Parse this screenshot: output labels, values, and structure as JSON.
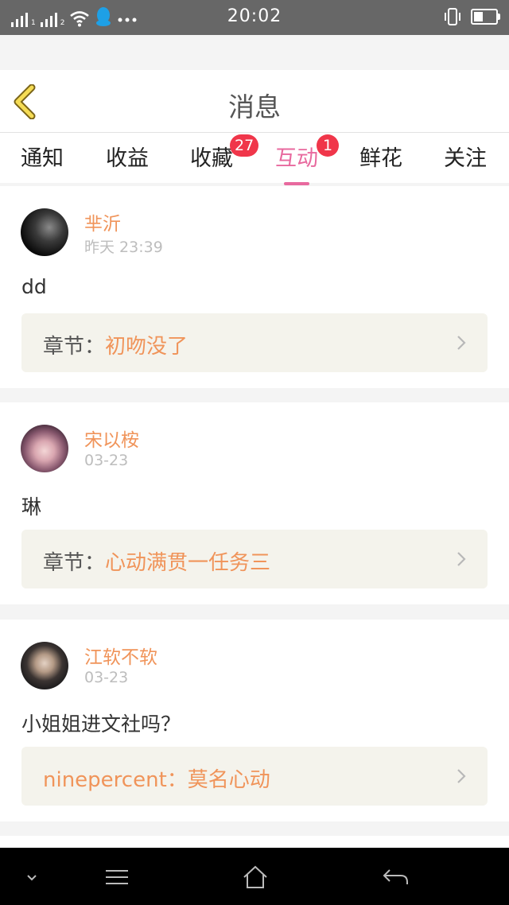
{
  "status_bar": {
    "time": "20:02",
    "sim1": "1",
    "sim2": "2"
  },
  "header": {
    "title": "消息"
  },
  "tabs": [
    {
      "label": "通知",
      "badge": ""
    },
    {
      "label": "收益",
      "badge": ""
    },
    {
      "label": "收藏",
      "badge": "27"
    },
    {
      "label": "互动",
      "badge": "1",
      "active": true
    },
    {
      "label": "鲜花",
      "badge": ""
    },
    {
      "label": "关注",
      "badge": ""
    }
  ],
  "messages": [
    {
      "user": "芈沂",
      "time": "昨天 23:39",
      "content": "dd",
      "chapter_label": "章节：",
      "chapter_value": "初吻没了"
    },
    {
      "user": "宋以桉",
      "time": "03-23",
      "content": "琳",
      "chapter_label": "章节：",
      "chapter_value": "心动满贯一任务三"
    },
    {
      "user": "江软不软",
      "time": "03-23",
      "content": "小姐姐进文社吗？",
      "chapter_label": "ninepercent：",
      "chapter_value": "莫名心动"
    }
  ],
  "colors": {
    "accent": "#e8699e",
    "username": "#f0945a",
    "badge": "#f0364a",
    "status_bar": "#676767"
  },
  "icons": {
    "back": "chevron-left-icon",
    "chapter_arrow": "chevron-right-icon",
    "bottom_nav": [
      "chevron-down-icon",
      "menu-icon",
      "home-icon",
      "back-arrow-icon"
    ]
  }
}
